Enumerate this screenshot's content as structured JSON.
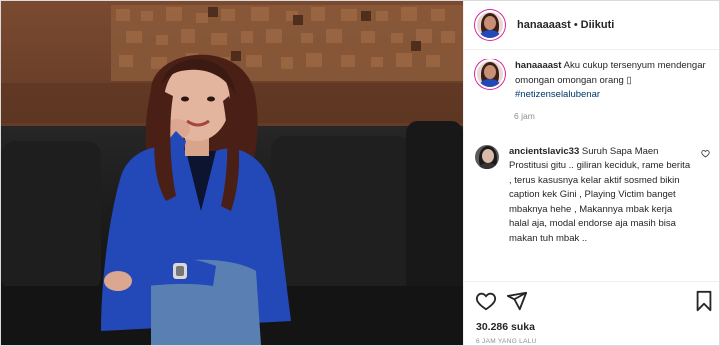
{
  "post": {
    "username": "hanaaaast",
    "separator": "•",
    "follow_status": "Diikuti",
    "caption": {
      "username": "hanaaaast",
      "text": "Aku cukup tersenyum mendengar omongan omongan orang ",
      "emoji": "▯",
      "hashtag": "#netizenselalubenar",
      "time": "6 jam"
    },
    "comments": [
      {
        "username": "ancientslavic33",
        "text": "Suruh Sapa Maen Prostitusi gitu .. giliran keciduk, rame berita , terus kasusnya kelar aktif sosmed bikin caption kek Gini , Playing Victim banget mbaknya hehe , Makannya mbak kerja halal aja, modal endorse aja masih bisa makan tuh mbak .."
      }
    ],
    "likes": "30.286 suka",
    "posted_ago": "6 JAM YANG LALU"
  },
  "icons": [
    "heart-icon",
    "share-icon",
    "bookmark-icon",
    "comment-like-icon"
  ],
  "colors": {
    "hashtag": "#00376b",
    "blazer": "#2348b8",
    "muted": "#8e8e8e"
  }
}
